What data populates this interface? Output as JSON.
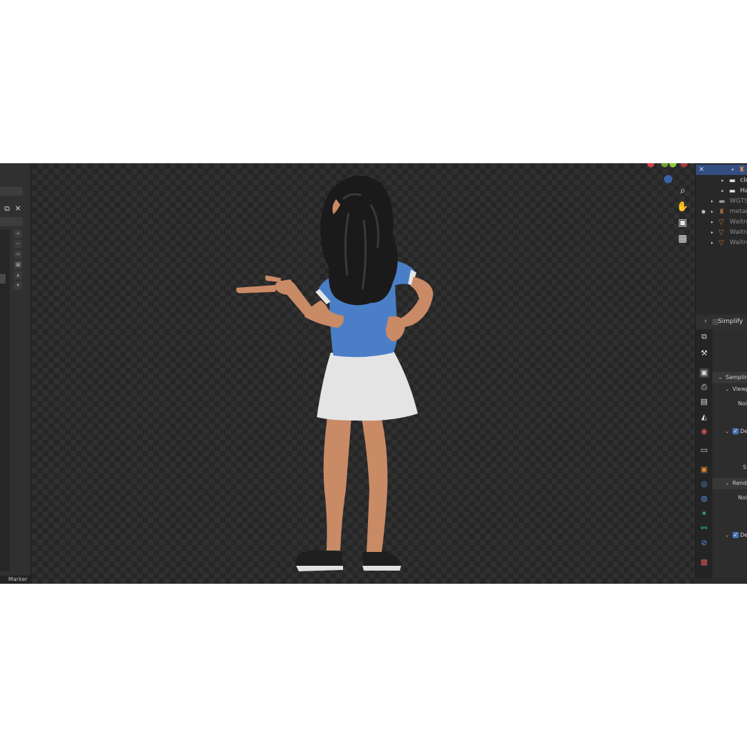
{
  "left_panel": {
    "marker_label": "Marker",
    "icons": [
      "copy-icon",
      "close-icon"
    ]
  },
  "outliner": {
    "rows": [
      {
        "label": "",
        "icon": "armature-icon"
      },
      {
        "label": "clo",
        "icon": "collection-icon"
      },
      {
        "label": "Ha",
        "icon": "collection-icon"
      },
      {
        "label": "WGTS_",
        "icon": "collection-icon"
      },
      {
        "label": "metar",
        "icon": "armature-icon"
      },
      {
        "label": "Waitre",
        "icon": "mesh-icon"
      },
      {
        "label": "Waitre",
        "icon": "mesh-icon"
      },
      {
        "label": "Waitre",
        "icon": "mesh-icon"
      }
    ]
  },
  "properties": {
    "header_label": "Simplify",
    "rows": [
      {
        "label": "Sampling"
      },
      {
        "label": "Viewp"
      },
      {
        "label": "Nois"
      },
      {
        "label": "De"
      },
      {
        "label": "S"
      },
      {
        "label": "Rende"
      },
      {
        "label": "Nois"
      },
      {
        "label": "De"
      }
    ]
  },
  "viewport": {
    "nav_tools": [
      "zoom-icon",
      "hand-pan-icon",
      "camera-icon",
      "grid-icon"
    ],
    "colors": {
      "shirt": "#4a7fc8",
      "skirt": "#e4e4e4",
      "hair": "#1a1a1a",
      "skin": "#c98a66",
      "shoes": "#1e1e1e"
    }
  }
}
